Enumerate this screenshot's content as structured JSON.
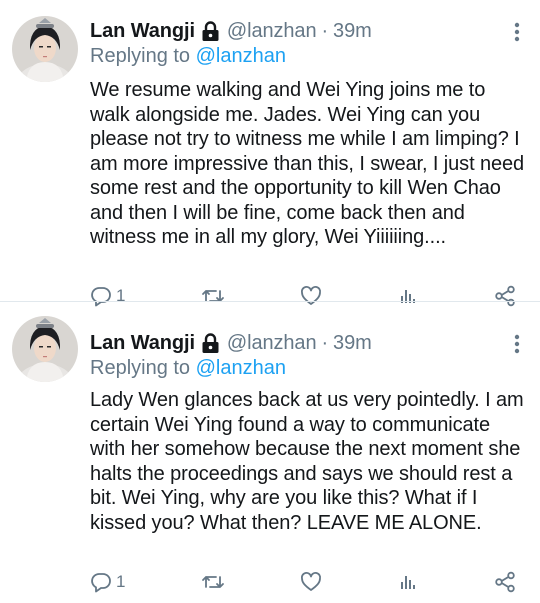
{
  "colors": {
    "accent": "#1da1f2",
    "muted": "#657786",
    "text": "#14171a",
    "divider": "#e1e8ed"
  },
  "tweets": [
    {
      "author": "Lan Wangji",
      "handle": "@lanzhan",
      "separator": "·",
      "time": "39m",
      "replying_prefix": "Replying to",
      "replying_to": "@lanzhan",
      "text": "We resume walking and Wei Ying joins me to walk alongside me. Jades. Wei Ying can you please not try to witness me while I am limping? I am more impressive than this, I swear, I just need some rest and the opportunity to kill Wen Chao and then I will be fine, come back then and witness me in all my glory, Wei Yiiiiiing....",
      "reply_count": "1",
      "icons": [
        "reply-icon",
        "retweet-icon",
        "like-icon",
        "analytics-icon",
        "share-icon"
      ]
    },
    {
      "author": "Lan Wangji",
      "handle": "@lanzhan",
      "separator": "·",
      "time": "39m",
      "replying_prefix": "Replying to",
      "replying_to": "@lanzhan",
      "text": "Lady Wen glances back at us very pointedly. I am certain Wei Ying found a way to communicate with her somehow because the next moment she halts the proceedings and says we should rest a bit. Wei Ying, why are you like this? What if I kissed you? What then? LEAVE ME ALONE.",
      "reply_count": "1",
      "icons": [
        "reply-icon",
        "retweet-icon",
        "like-icon",
        "analytics-icon",
        "share-icon"
      ]
    }
  ]
}
